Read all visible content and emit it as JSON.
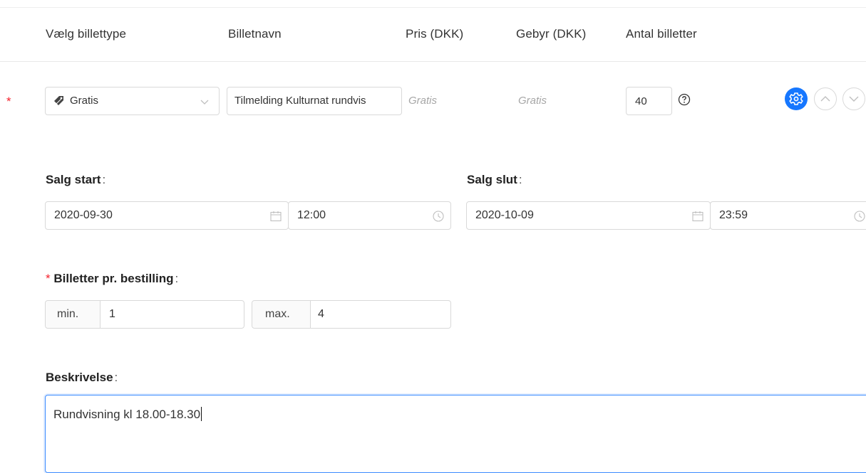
{
  "table": {
    "headers": [
      "Vælg billettype",
      "Billetnavn",
      "Pris (DKK)",
      "Gebyr (DKK)",
      "Antal billetter"
    ],
    "row": {
      "required_mark": "*",
      "ticket_type": "Gratis",
      "ticket_name": "Tilmelding Kulturnat rundvis",
      "price": "Gratis",
      "fee": "Gratis",
      "quantity": "40"
    }
  },
  "sale": {
    "start_label": "Salg start",
    "start_date": "2020-09-30",
    "start_time": "12:00",
    "end_label": "Salg slut",
    "end_date": "2020-10-09",
    "end_time": "23:59"
  },
  "per_order": {
    "required_mark": "*",
    "label": "Billetter pr. bestilling",
    "min_label": "min.",
    "min_value": "1",
    "max_label": "max.",
    "max_value": "4"
  },
  "description": {
    "label": "Beskrivelse",
    "value": "Rundvisning kl 18.00-18.30"
  },
  "colon": ":",
  "colors": {
    "primary": "#1677ff",
    "required": "#f5222d",
    "border": "#d9d9d9"
  },
  "icons": [
    "tag-icon",
    "chevron-down-icon",
    "question-circle-icon",
    "gear-icon",
    "chevron-up-icon",
    "calendar-icon",
    "clock-icon"
  ]
}
